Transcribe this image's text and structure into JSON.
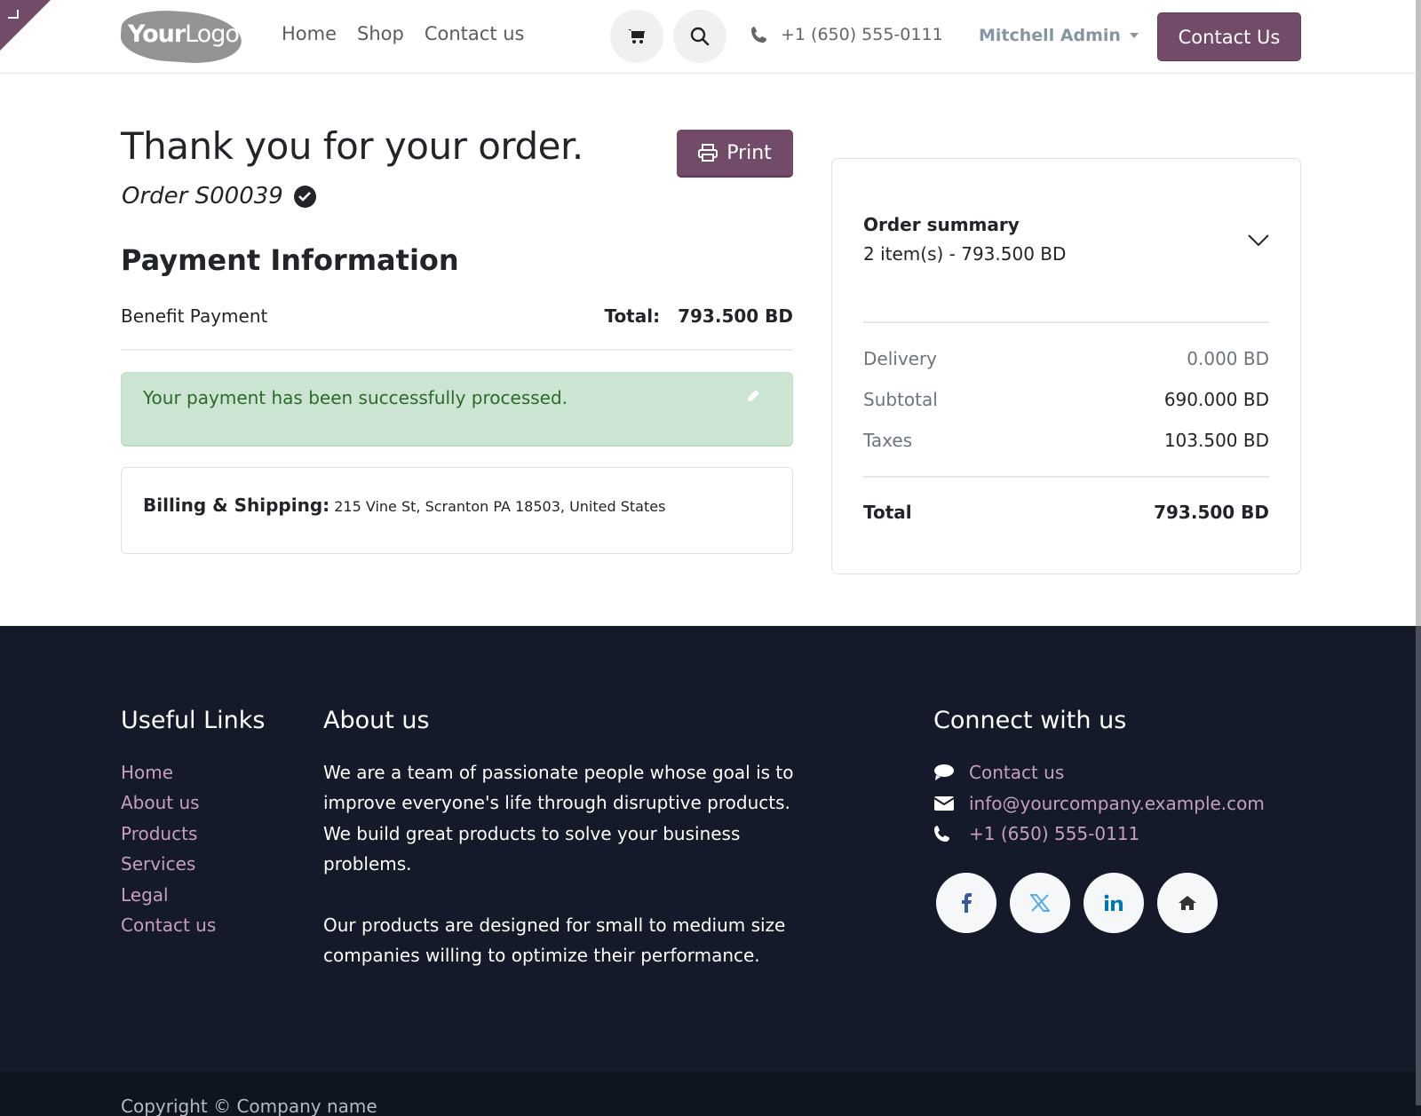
{
  "header": {
    "logo": {
      "bold": "Your",
      "light": "Logo"
    },
    "nav": [
      "Home",
      "Shop",
      "Contact us"
    ],
    "phone": "+1 (650) 555-0111",
    "user": "Mitchell Admin",
    "cta_label": "Contact Us"
  },
  "main": {
    "title": "Thank you for your order.",
    "print_label": "Print",
    "order_number": "Order S00039",
    "payment_heading": "Payment Information",
    "payment_method": "Benefit Payment",
    "total_label": "Total:",
    "total_value": "793.500 BD",
    "alert_message": "Your payment has been successfully processed.",
    "address_label": "Billing & Shipping:",
    "address_value": "215 Vine St, Scranton PA 18503, United States"
  },
  "summary": {
    "title": "Order summary",
    "subtitle": "2 item(s) -  793.500 BD",
    "rows": [
      {
        "label": "Delivery",
        "value": "0.000 BD"
      },
      {
        "label": "Subtotal",
        "value": "690.000 BD"
      },
      {
        "label": "Taxes",
        "value": "103.500 BD"
      }
    ],
    "total_label": "Total",
    "total_value": "793.500 BD"
  },
  "footer": {
    "useful_links_heading": "Useful Links",
    "useful_links": [
      "Home",
      "About us",
      "Products",
      "Services",
      "Legal",
      "Contact us"
    ],
    "about_heading": "About us",
    "about_paragraphs": [
      "We are a team of passionate people whose goal is to improve everyone's life through disruptive products. We build great products to solve your business problems.",
      "Our products are designed for small to medium size companies willing to optimize their performance."
    ],
    "connect_heading": "Connect with us",
    "connect_items": [
      {
        "icon": "comment-icon",
        "label": "Contact us"
      },
      {
        "icon": "envelope-icon",
        "label": "info@yourcompany.example.com"
      },
      {
        "icon": "phone-icon",
        "label": "+1 (650) 555-0111"
      }
    ],
    "socials": [
      "facebook",
      "x-twitter",
      "linkedin",
      "home"
    ],
    "copyright": "Copyright © Company name"
  },
  "colors": {
    "brand": "#714b67",
    "link": "#c79ec0",
    "footer_bg": "#141a29",
    "alert_bg": "#cce5d3",
    "alert_text": "#2b6a2b"
  }
}
